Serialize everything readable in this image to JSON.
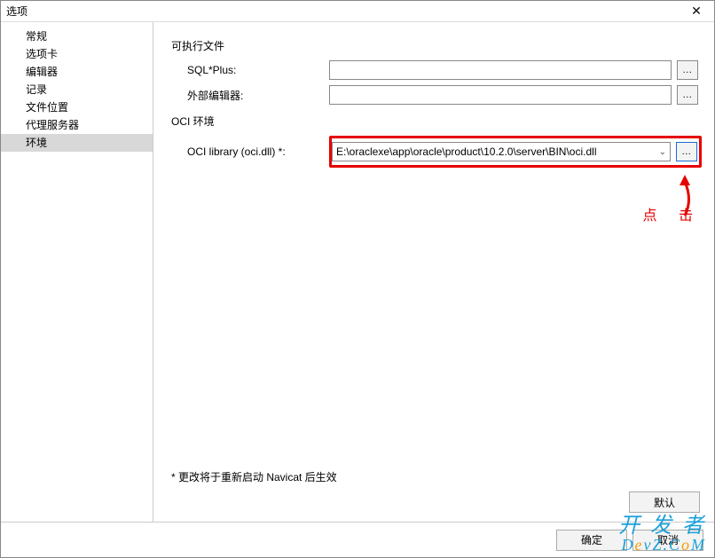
{
  "window": {
    "title": "选项",
    "close": "✕"
  },
  "sidebar": {
    "items": [
      {
        "label": "常规"
      },
      {
        "label": "选项卡"
      },
      {
        "label": "编辑器"
      },
      {
        "label": "记录"
      },
      {
        "label": "文件位置"
      },
      {
        "label": "代理服务器"
      },
      {
        "label": "环境",
        "selected": true
      }
    ]
  },
  "content": {
    "sec1": {
      "title": "可执行文件"
    },
    "row_sqlplus": {
      "label": "SQL*Plus:",
      "value": "",
      "browse": "..."
    },
    "row_ext_editor": {
      "label": "外部编辑器:",
      "value": "",
      "browse": "..."
    },
    "sec2": {
      "title": "OCI 环境"
    },
    "row_oci": {
      "label": "OCI library (oci.dll) *:",
      "value": "E:\\oraclexe\\app\\oracle\\product\\10.2.0\\server\\BIN\\oci.dll",
      "browse": "..."
    },
    "note": "* 更改将于重新启动 Navicat 后生效",
    "default_btn": "默认"
  },
  "dialog_buttons": {
    "ok": "确定",
    "cancel": "取消"
  },
  "annotation": {
    "click": "点 击"
  },
  "watermark": {
    "l1": "开 发 者",
    "l2a": "D",
    "l2b": "e",
    "l2c": "vZ.C",
    "l2d": "o",
    "l2e": "M"
  }
}
